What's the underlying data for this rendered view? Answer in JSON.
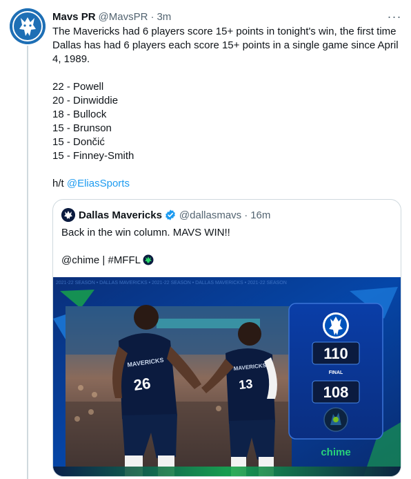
{
  "tweet": {
    "author_name": "Mavs PR",
    "author_handle": "@MavsPR",
    "separator": "·",
    "time": "3m",
    "more_label": "···",
    "text_intro": "The Mavericks had 6 players score 15+ points in tonight's win, the first time Dallas has had 6 players each score 15+ points in a single game since April 4, 1989.",
    "stat_lines": [
      "22 - Powell",
      "20 - Dinwiddie",
      "18 - Bullock",
      "15 - Brunson",
      "15 - Dončić",
      "15 - Finney-Smith"
    ],
    "hat_tip_prefix": "h/t ",
    "hat_tip_link": "@EliasSports"
  },
  "quote": {
    "author_name": "Dallas Mavericks",
    "author_handle": "@dallasmavs",
    "separator": "·",
    "time": "16m",
    "line1": "Back in the win column. MAVS WIN!!",
    "line2": "@chime | #MFFL",
    "media": {
      "home_score": "110",
      "status": "FINAL",
      "away_score": "108",
      "sponsor": "chime",
      "jersey_left_team": "MAVERICKS",
      "jersey_left_number": "26",
      "jersey_right_team": "MAVERICKS",
      "jersey_right_number": "13",
      "banner_text": "2021-22 SEASON • DALLAS MAVERICKS • 2021-22 SEASON • DALLAS MAVERICKS • 2021-22 SEASON",
      "colors": {
        "mavs_blue": "#0053bc",
        "navy": "#0b1b3f",
        "green": "#2bd96b",
        "chime_green": "#29d37a"
      }
    }
  }
}
